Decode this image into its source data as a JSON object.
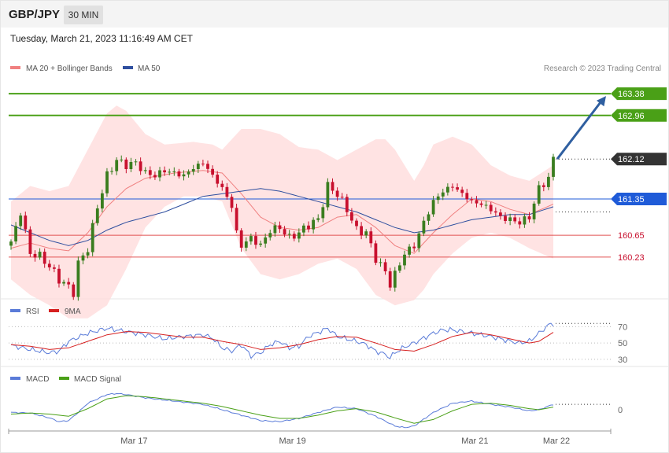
{
  "header": {
    "pair": "GBP/JPY",
    "timeframe": "30 MIN"
  },
  "datetime": "Tuesday, March 21, 2023 11:16:49 AM CET",
  "colors": {
    "up": "#3a7d1f",
    "down": "#c8102e",
    "ma20": "#f08080",
    "band": "#ffd9d9",
    "ma50": "#2f4f9f",
    "rsi": "#5a7bd8",
    "rsi_ma": "#d62020",
    "macd": "#5a7bd8",
    "signal": "#4aa017",
    "green_level": "#4aa017",
    "blue_level": "#1f5bd8",
    "red_level": "#e05050",
    "arrow": "#2f5fa0"
  },
  "chart_data": [
    {
      "type": "candlestick",
      "title": "",
      "legend": [
        {
          "name": "MA 20 + Bollinger Bands",
          "color": "#f08080"
        },
        {
          "name": "MA 50",
          "color": "#2f4f9f"
        }
      ],
      "legend_position": "top-left",
      "attribution": "Research © 2023 Trading Central",
      "x_ticks": [
        "Mar 17",
        "Mar 19",
        "Mar 21",
        "Mar 22"
      ],
      "ylim": [
        159.5,
        163.7
      ],
      "last_price": 162.12,
      "levels": [
        {
          "value": 163.38,
          "label": "163.38",
          "style": "resistance"
        },
        {
          "value": 162.96,
          "label": "162.96",
          "style": "resistance"
        },
        {
          "value": 161.35,
          "label": "161.35",
          "style": "pivot"
        },
        {
          "value": 160.65,
          "label": "160.65",
          "style": "support"
        },
        {
          "value": 160.23,
          "label": "160.23",
          "style": "support"
        }
      ],
      "arrow": {
        "from": 162.12,
        "to": 163.38
      },
      "close_path": [
        [
          0,
          160.5
        ],
        [
          2,
          161.1
        ],
        [
          4,
          160.3
        ],
        [
          6,
          160.25
        ],
        [
          8,
          160.05
        ],
        [
          10,
          159.8
        ],
        [
          12,
          159.65
        ],
        [
          13,
          159.55
        ],
        [
          14,
          160.1
        ],
        [
          16,
          160.4
        ],
        [
          18,
          161.2
        ],
        [
          20,
          161.8
        ],
        [
          22,
          162.1
        ],
        [
          24,
          162.0
        ],
        [
          26,
          162.05
        ],
        [
          28,
          161.85
        ],
        [
          30,
          161.8
        ],
        [
          32,
          161.9
        ],
        [
          34,
          161.85
        ],
        [
          36,
          161.8
        ],
        [
          38,
          161.95
        ],
        [
          40,
          162.05
        ],
        [
          42,
          161.8
        ],
        [
          44,
          161.55
        ],
        [
          45,
          161.4
        ],
        [
          46,
          161.2
        ],
        [
          47,
          160.7
        ],
        [
          48,
          160.45
        ],
        [
          50,
          160.6
        ],
        [
          52,
          160.45
        ],
        [
          54,
          160.75
        ],
        [
          56,
          160.8
        ],
        [
          58,
          160.6
        ],
        [
          60,
          160.7
        ],
        [
          62,
          160.85
        ],
        [
          64,
          160.95
        ],
        [
          66,
          161.6
        ],
        [
          68,
          161.45
        ],
        [
          70,
          161.15
        ],
        [
          72,
          160.75
        ],
        [
          74,
          160.7
        ],
        [
          76,
          160.2
        ],
        [
          78,
          159.95
        ],
        [
          79,
          159.7
        ],
        [
          80,
          159.9
        ],
        [
          82,
          160.3
        ],
        [
          84,
          160.45
        ],
        [
          86,
          160.9
        ],
        [
          88,
          161.3
        ],
        [
          90,
          161.5
        ],
        [
          92,
          161.6
        ],
        [
          94,
          161.45
        ],
        [
          96,
          161.3
        ],
        [
          98,
          161.25
        ],
        [
          100,
          161.15
        ],
        [
          102,
          161.0
        ],
        [
          104,
          160.95
        ],
        [
          106,
          160.9
        ],
        [
          108,
          161.0
        ],
        [
          110,
          161.55
        ],
        [
          112,
          161.75
        ],
        [
          113,
          162.12
        ]
      ],
      "ma20": [
        [
          0,
          160.4
        ],
        [
          4,
          160.5
        ],
        [
          8,
          160.4
        ],
        [
          12,
          160.35
        ],
        [
          16,
          160.7
        ],
        [
          20,
          161.2
        ],
        [
          24,
          161.55
        ],
        [
          28,
          161.75
        ],
        [
          34,
          161.85
        ],
        [
          40,
          161.9
        ],
        [
          44,
          161.85
        ],
        [
          48,
          161.45
        ],
        [
          52,
          161.0
        ],
        [
          56,
          160.8
        ],
        [
          60,
          160.75
        ],
        [
          64,
          160.8
        ],
        [
          68,
          161.0
        ],
        [
          72,
          161.05
        ],
        [
          76,
          160.8
        ],
        [
          80,
          160.45
        ],
        [
          84,
          160.3
        ],
        [
          88,
          160.7
        ],
        [
          92,
          161.05
        ],
        [
          96,
          161.35
        ],
        [
          100,
          161.3
        ],
        [
          104,
          161.15
        ],
        [
          108,
          161.05
        ],
        [
          113,
          161.25
        ]
      ],
      "ma50": [
        [
          0,
          160.85
        ],
        [
          4,
          160.7
        ],
        [
          8,
          160.55
        ],
        [
          12,
          160.45
        ],
        [
          16,
          160.55
        ],
        [
          20,
          160.75
        ],
        [
          24,
          160.9
        ],
        [
          28,
          161.0
        ],
        [
          32,
          161.1
        ],
        [
          36,
          161.25
        ],
        [
          40,
          161.4
        ],
        [
          44,
          161.45
        ],
        [
          48,
          161.5
        ],
        [
          52,
          161.55
        ],
        [
          56,
          161.5
        ],
        [
          60,
          161.4
        ],
        [
          64,
          161.3
        ],
        [
          68,
          161.2
        ],
        [
          72,
          161.1
        ],
        [
          76,
          160.95
        ],
        [
          80,
          160.8
        ],
        [
          84,
          160.7
        ],
        [
          88,
          160.75
        ],
        [
          92,
          160.85
        ],
        [
          96,
          160.95
        ],
        [
          100,
          161.0
        ],
        [
          104,
          161.05
        ],
        [
          108,
          161.05
        ],
        [
          113,
          161.2
        ]
      ],
      "bb_upper": [
        [
          0,
          161.3
        ],
        [
          4,
          161.6
        ],
        [
          8,
          161.5
        ],
        [
          12,
          161.6
        ],
        [
          16,
          162.3
        ],
        [
          20,
          163.0
        ],
        [
          22,
          163.15
        ],
        [
          24,
          163.05
        ],
        [
          28,
          162.6
        ],
        [
          32,
          162.4
        ],
        [
          38,
          162.45
        ],
        [
          42,
          162.4
        ],
        [
          44,
          162.3
        ],
        [
          48,
          162.7
        ],
        [
          52,
          162.7
        ],
        [
          56,
          162.6
        ],
        [
          60,
          162.35
        ],
        [
          64,
          162.3
        ],
        [
          68,
          162.1
        ],
        [
          72,
          162.3
        ],
        [
          76,
          162.5
        ],
        [
          78,
          162.5
        ],
        [
          80,
          162.3
        ],
        [
          84,
          161.7
        ],
        [
          86,
          162.0
        ],
        [
          88,
          162.4
        ],
        [
          92,
          162.55
        ],
        [
          96,
          162.4
        ],
        [
          100,
          162.0
        ],
        [
          104,
          161.8
        ],
        [
          108,
          161.7
        ],
        [
          113,
          162.0
        ]
      ],
      "bb_lower": [
        [
          0,
          159.8
        ],
        [
          4,
          159.5
        ],
        [
          8,
          159.3
        ],
        [
          12,
          159.05
        ],
        [
          16,
          159.05
        ],
        [
          20,
          159.3
        ],
        [
          24,
          160.0
        ],
        [
          28,
          160.8
        ],
        [
          32,
          161.2
        ],
        [
          36,
          161.4
        ],
        [
          40,
          161.4
        ],
        [
          44,
          161.3
        ],
        [
          48,
          160.4
        ],
        [
          52,
          159.9
        ],
        [
          56,
          159.8
        ],
        [
          60,
          159.9
        ],
        [
          64,
          160.1
        ],
        [
          68,
          160.2
        ],
        [
          72,
          160.0
        ],
        [
          76,
          159.5
        ],
        [
          80,
          159.3
        ],
        [
          84,
          159.4
        ],
        [
          86,
          159.6
        ],
        [
          88,
          159.9
        ],
        [
          92,
          160.3
        ],
        [
          96,
          160.6
        ],
        [
          100,
          160.7
        ],
        [
          104,
          160.6
        ],
        [
          108,
          160.4
        ],
        [
          113,
          160.2
        ]
      ]
    },
    {
      "type": "line",
      "title": "",
      "legend": [
        {
          "name": "RSI",
          "color": "#5a7bd8"
        },
        {
          "name": "9MA",
          "color": "#d62020"
        }
      ],
      "y_ticks": [
        70,
        50,
        30
      ],
      "ylim": [
        25,
        80
      ],
      "rsi": [
        [
          0,
          47
        ],
        [
          4,
          42
        ],
        [
          8,
          38
        ],
        [
          10,
          40
        ],
        [
          12,
          52
        ],
        [
          16,
          62
        ],
        [
          20,
          68
        ],
        [
          24,
          64
        ],
        [
          28,
          60
        ],
        [
          32,
          55
        ],
        [
          36,
          58
        ],
        [
          40,
          60
        ],
        [
          42,
          56
        ],
        [
          44,
          44
        ],
        [
          46,
          40
        ],
        [
          48,
          48
        ],
        [
          50,
          34
        ],
        [
          52,
          38
        ],
        [
          54,
          48
        ],
        [
          56,
          52
        ],
        [
          58,
          44
        ],
        [
          60,
          46
        ],
        [
          62,
          58
        ],
        [
          64,
          63
        ],
        [
          66,
          68
        ],
        [
          68,
          58
        ],
        [
          70,
          55
        ],
        [
          72,
          52
        ],
        [
          74,
          48
        ],
        [
          76,
          40
        ],
        [
          78,
          36
        ],
        [
          79,
          32
        ],
        [
          80,
          38
        ],
        [
          82,
          45
        ],
        [
          84,
          50
        ],
        [
          86,
          56
        ],
        [
          88,
          62
        ],
        [
          90,
          66
        ],
        [
          92,
          66
        ],
        [
          94,
          64
        ],
        [
          96,
          62
        ],
        [
          98,
          60
        ],
        [
          100,
          58
        ],
        [
          102,
          55
        ],
        [
          104,
          52
        ],
        [
          106,
          50
        ],
        [
          108,
          52
        ],
        [
          110,
          62
        ],
        [
          112,
          72
        ],
        [
          113,
          74
        ]
      ],
      "ma9": [
        [
          0,
          48
        ],
        [
          4,
          46
        ],
        [
          8,
          42
        ],
        [
          12,
          44
        ],
        [
          16,
          52
        ],
        [
          20,
          60
        ],
        [
          24,
          64
        ],
        [
          28,
          63
        ],
        [
          32,
          60
        ],
        [
          36,
          57
        ],
        [
          40,
          57
        ],
        [
          44,
          52
        ],
        [
          48,
          48
        ],
        [
          52,
          42
        ],
        [
          56,
          44
        ],
        [
          60,
          48
        ],
        [
          64,
          54
        ],
        [
          68,
          58
        ],
        [
          72,
          57
        ],
        [
          76,
          50
        ],
        [
          80,
          42
        ],
        [
          84,
          40
        ],
        [
          88,
          48
        ],
        [
          92,
          58
        ],
        [
          96,
          63
        ],
        [
          100,
          60
        ],
        [
          104,
          55
        ],
        [
          108,
          50
        ],
        [
          110,
          52
        ],
        [
          113,
          63
        ]
      ]
    },
    {
      "type": "line",
      "title": "",
      "legend": [
        {
          "name": "MACD",
          "color": "#5a7bd8"
        },
        {
          "name": "MACD Signal",
          "color": "#4aa017"
        }
      ],
      "y_ticks": [
        0
      ],
      "ylim": [
        -0.45,
        0.45
      ],
      "macd": [
        [
          0,
          -0.05
        ],
        [
          4,
          -0.06
        ],
        [
          8,
          -0.15
        ],
        [
          10,
          -0.22
        ],
        [
          12,
          -0.2
        ],
        [
          14,
          -0.05
        ],
        [
          16,
          0.12
        ],
        [
          20,
          0.28
        ],
        [
          22,
          0.3
        ],
        [
          24,
          0.28
        ],
        [
          28,
          0.22
        ],
        [
          32,
          0.18
        ],
        [
          36,
          0.14
        ],
        [
          40,
          0.1
        ],
        [
          44,
          0.0
        ],
        [
          48,
          -0.1
        ],
        [
          52,
          -0.2
        ],
        [
          56,
          -0.22
        ],
        [
          60,
          -0.16
        ],
        [
          64,
          -0.05
        ],
        [
          68,
          0.05
        ],
        [
          72,
          0.02
        ],
        [
          76,
          -0.12
        ],
        [
          80,
          -0.3
        ],
        [
          82,
          -0.33
        ],
        [
          84,
          -0.3
        ],
        [
          88,
          -0.05
        ],
        [
          92,
          0.12
        ],
        [
          96,
          0.16
        ],
        [
          100,
          0.1
        ],
        [
          104,
          0.05
        ],
        [
          108,
          -0.02
        ],
        [
          110,
          0.0
        ],
        [
          113,
          0.1
        ]
      ],
      "signal": [
        [
          0,
          -0.08
        ],
        [
          4,
          -0.06
        ],
        [
          8,
          -0.08
        ],
        [
          12,
          -0.12
        ],
        [
          16,
          0.02
        ],
        [
          20,
          0.2
        ],
        [
          24,
          0.26
        ],
        [
          28,
          0.24
        ],
        [
          32,
          0.2
        ],
        [
          36,
          0.16
        ],
        [
          40,
          0.12
        ],
        [
          44,
          0.06
        ],
        [
          48,
          -0.02
        ],
        [
          52,
          -0.1
        ],
        [
          56,
          -0.16
        ],
        [
          60,
          -0.16
        ],
        [
          64,
          -0.1
        ],
        [
          68,
          -0.02
        ],
        [
          72,
          0.02
        ],
        [
          76,
          -0.04
        ],
        [
          80,
          -0.15
        ],
        [
          84,
          -0.25
        ],
        [
          88,
          -0.18
        ],
        [
          92,
          -0.02
        ],
        [
          96,
          0.1
        ],
        [
          100,
          0.12
        ],
        [
          104,
          0.08
        ],
        [
          108,
          0.02
        ],
        [
          110,
          0.0
        ],
        [
          113,
          0.05
        ]
      ]
    }
  ]
}
